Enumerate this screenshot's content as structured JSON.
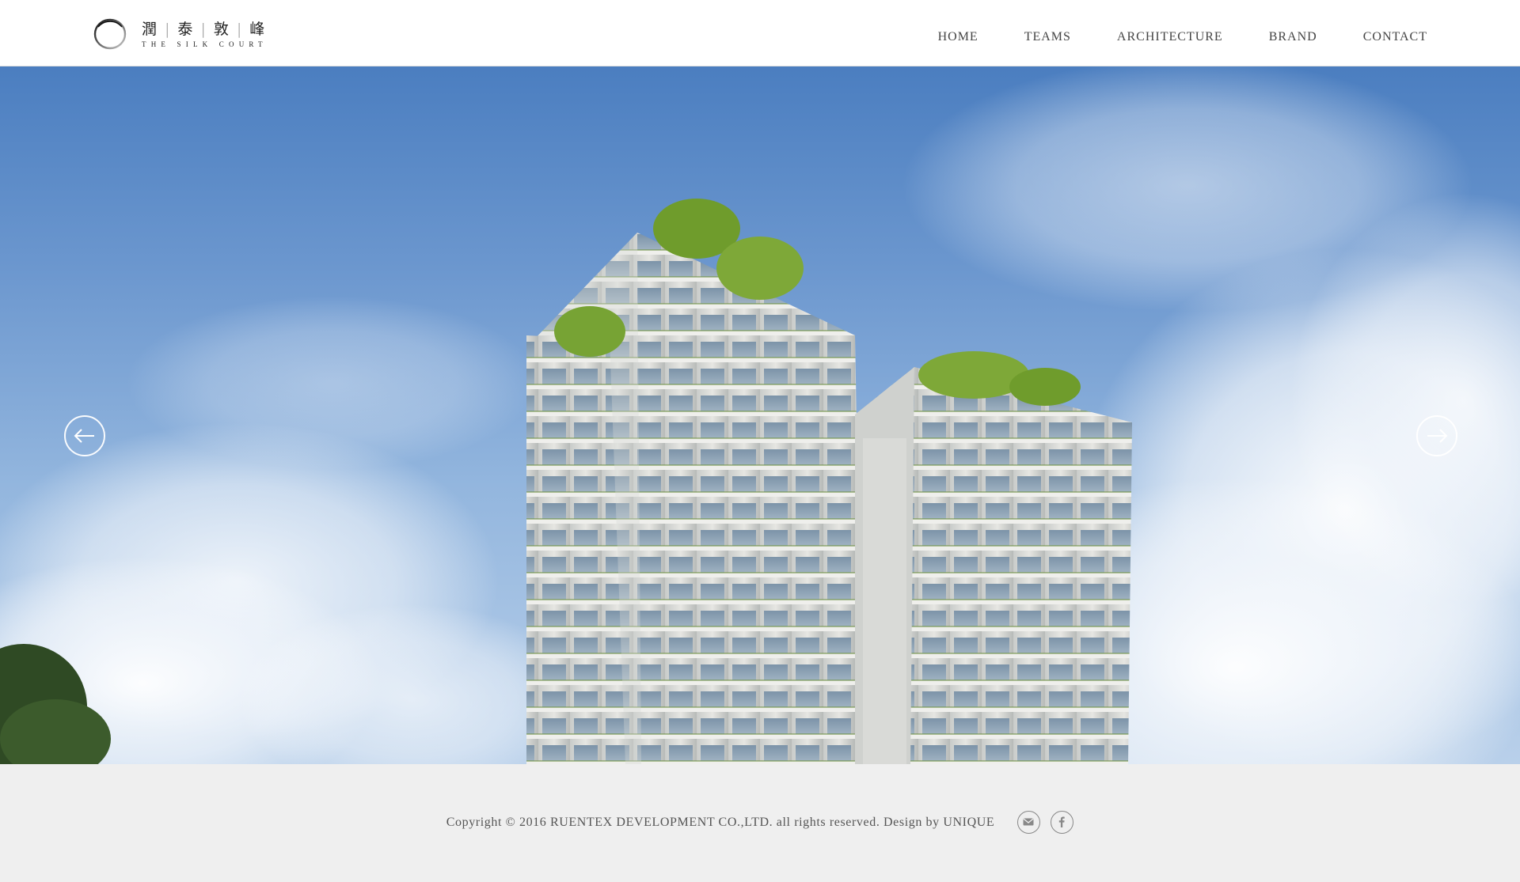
{
  "brand": {
    "name_cn_1": "潤",
    "name_cn_2": "泰",
    "name_cn_3": "敦",
    "name_cn_4": "峰",
    "name_en": "The Silk Court"
  },
  "nav": {
    "items": [
      "HOME",
      "TEAMS",
      "ARCHITECTURE",
      "BRAND",
      "CONTACT"
    ]
  },
  "hero": {
    "prev_icon": "arrow-left-icon",
    "next_icon": "arrow-right-icon"
  },
  "footer": {
    "copyright": "Copyright © 2016 RUENTEX DEVELOPMENT CO.,LTD. all rights reserved. Design by UNIQUE",
    "social": [
      "mail-icon",
      "facebook-icon"
    ]
  },
  "colors": {
    "sky_top": "#4b7ec0",
    "sky_bottom": "#b9d0ea",
    "footer_bg": "#efefef",
    "nav_text": "#444444"
  }
}
